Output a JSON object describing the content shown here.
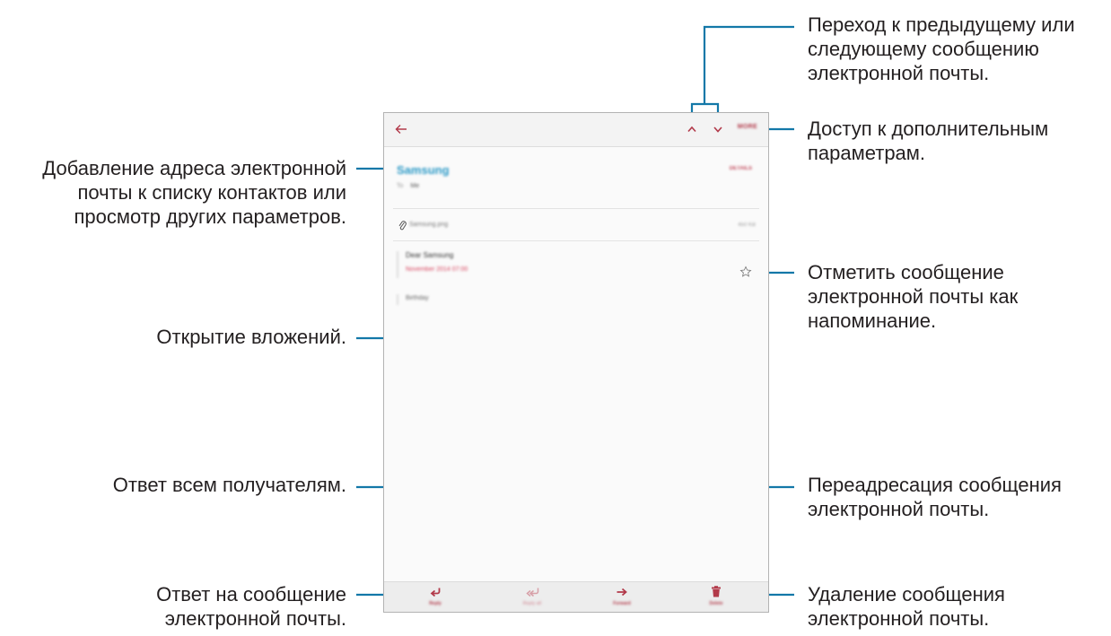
{
  "callouts": {
    "nav_prev_next": "Переход к предыдущему или\nследующему сообщению\nэлектронной почты.",
    "more_options": "Доступ к дополнительным\nпараметрам.",
    "add_contact": "Добавление адреса электронной\nпочты к списку контактов или\nпросмотр других параметров.",
    "star": "Отметить сообщение\nэлектронной почты как\nнапоминание.",
    "open_attachments": "Открытие вложений.",
    "reply_all": "Ответ всем получателям.",
    "forward": "Переадресация сообщения\nэлектронной почты.",
    "reply": "Ответ на сообщение\nэлектронной почты.",
    "delete": "Удаление сообщения\nэлектронной почты."
  },
  "screen": {
    "appbar": {
      "more_label": "MORE"
    },
    "header": {
      "sender": "Samsung",
      "details_label": "DETAILS",
      "to_label": "To",
      "to_value": "Me"
    },
    "attachment": {
      "name": "Samsung.png",
      "size": "450 KB"
    },
    "message": {
      "subject": "Dear Samsung",
      "date": "November 2014 07:00",
      "body": "Birthday"
    },
    "bottom_bar": [
      {
        "label": "Reply",
        "icon": "reply-icon",
        "enabled": true
      },
      {
        "label": "Reply all",
        "icon": "reply-all-icon",
        "enabled": false
      },
      {
        "label": "Forward",
        "icon": "forward-icon",
        "enabled": true
      },
      {
        "label": "Delete",
        "icon": "trash-icon",
        "enabled": true
      }
    ]
  },
  "colors": {
    "leader": "#1378a8",
    "accent": "#b23a4a",
    "sender": "#2d9ac7"
  }
}
